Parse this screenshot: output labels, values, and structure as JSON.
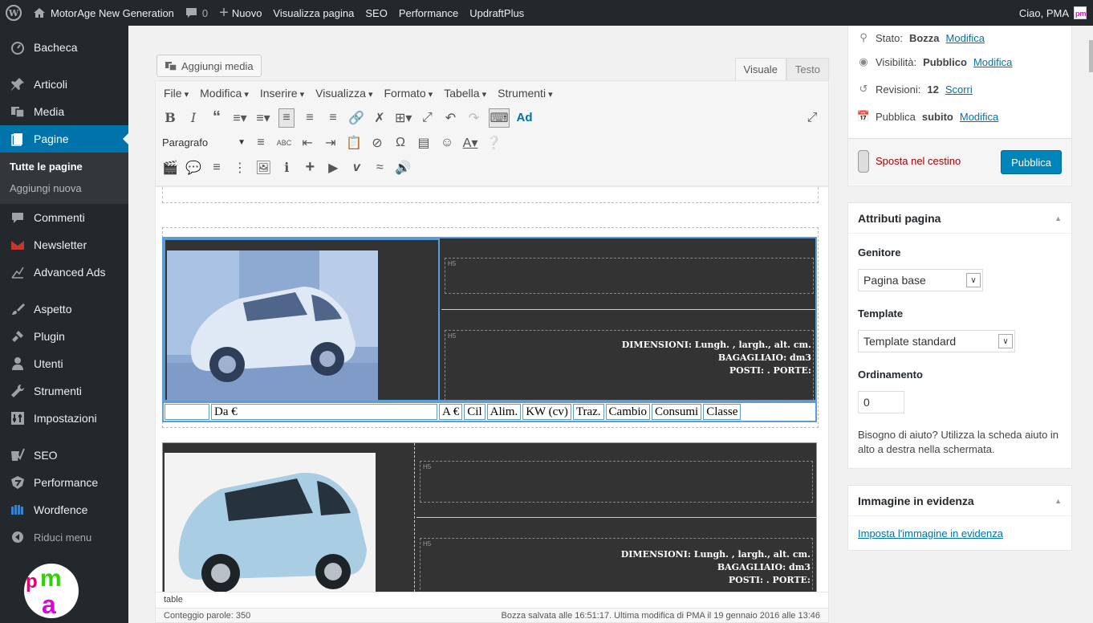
{
  "adminbar": {
    "site_name": "MotorAge New Generation",
    "comments_count": "0",
    "new_label": "Nuovo",
    "view_page": "Visualizza pagina",
    "seo": "SEO",
    "performance": "Performance",
    "updraft": "UpdraftPlus",
    "greeting": "Ciao, PMA"
  },
  "sidebar": {
    "items": [
      {
        "label": "Bacheca",
        "icon": "dashboard-icon"
      },
      {
        "label": "Articoli",
        "icon": "pin-icon"
      },
      {
        "label": "Media",
        "icon": "media-icon"
      },
      {
        "label": "Pagine",
        "icon": "pages-icon"
      },
      {
        "label": "Commenti",
        "icon": "comment-icon"
      },
      {
        "label": "Newsletter",
        "icon": "mail-icon"
      },
      {
        "label": "Advanced Ads",
        "icon": "chart-icon"
      },
      {
        "label": "Aspetto",
        "icon": "brush-icon"
      },
      {
        "label": "Plugin",
        "icon": "plugin-icon"
      },
      {
        "label": "Utenti",
        "icon": "user-icon"
      },
      {
        "label": "Strumenti",
        "icon": "wrench-icon"
      },
      {
        "label": "Impostazioni",
        "icon": "settings-icon"
      },
      {
        "label": "SEO",
        "icon": "seo-icon"
      },
      {
        "label": "Performance",
        "icon": "performance-icon"
      },
      {
        "label": "Wordfence",
        "icon": "wordfence-icon"
      },
      {
        "label": "Riduci menu",
        "icon": "collapse-icon"
      }
    ],
    "submenu": [
      "Tutte le pagine",
      "Aggiungi nuova"
    ]
  },
  "editor": {
    "add_media": "Aggiungi media",
    "tab_visual": "Visuale",
    "tab_text": "Testo",
    "menu": [
      "File",
      "Modifica",
      "Inserire",
      "Visualizza",
      "Formato",
      "Tabella",
      "Strumenti"
    ],
    "format_select": "Paragrafo",
    "ad_button": "Ad",
    "specs": [
      "DIMENSIONI: Lungh. , largh., alt. cm.",
      "BAGAGLIAIO: dm3",
      "POSTI: . PORTE:"
    ],
    "h_label": "H5",
    "spec_cells": [
      "",
      "Da €",
      "A €",
      "Cil",
      "Alim.",
      "KW (cv)",
      "Traz.",
      "Cambio",
      "Consumi",
      "Classe"
    ],
    "path": "table",
    "word_count": "Conteggio parole: 350",
    "saved": "Bozza salvata alle 16:51:17. Ultima modifica di PMA il 19 gennaio 2016 alle 13:46"
  },
  "publish": {
    "status_label": "Stato:",
    "status_value": "Bozza",
    "visibility_label": "Visibilità:",
    "visibility_value": "Pubblico",
    "revisions_label": "Revisioni:",
    "revisions_value": "12",
    "scroll_link": "Scorri",
    "publish_label": "Pubblica",
    "publish_when": "subito",
    "edit_link": "Modifica",
    "trash": "Sposta nel cestino",
    "publish_button": "Pubblica"
  },
  "attributes": {
    "title": "Attributi pagina",
    "parent_label": "Genitore",
    "parent_value": "Pagina base",
    "template_label": "Template",
    "template_value": "Template standard",
    "order_label": "Ordinamento",
    "order_value": "0",
    "help": "Bisogno di aiuto? Utilizza la scheda aiuto in alto a destra nella schermata."
  },
  "featured": {
    "title": "Immagine in evidenza",
    "link": "Imposta l'immagine in evidenza"
  },
  "colors": {
    "adminbar": "#23282d",
    "accent": "#0073aa",
    "publish": "#0085ba",
    "trash": "#a00"
  }
}
